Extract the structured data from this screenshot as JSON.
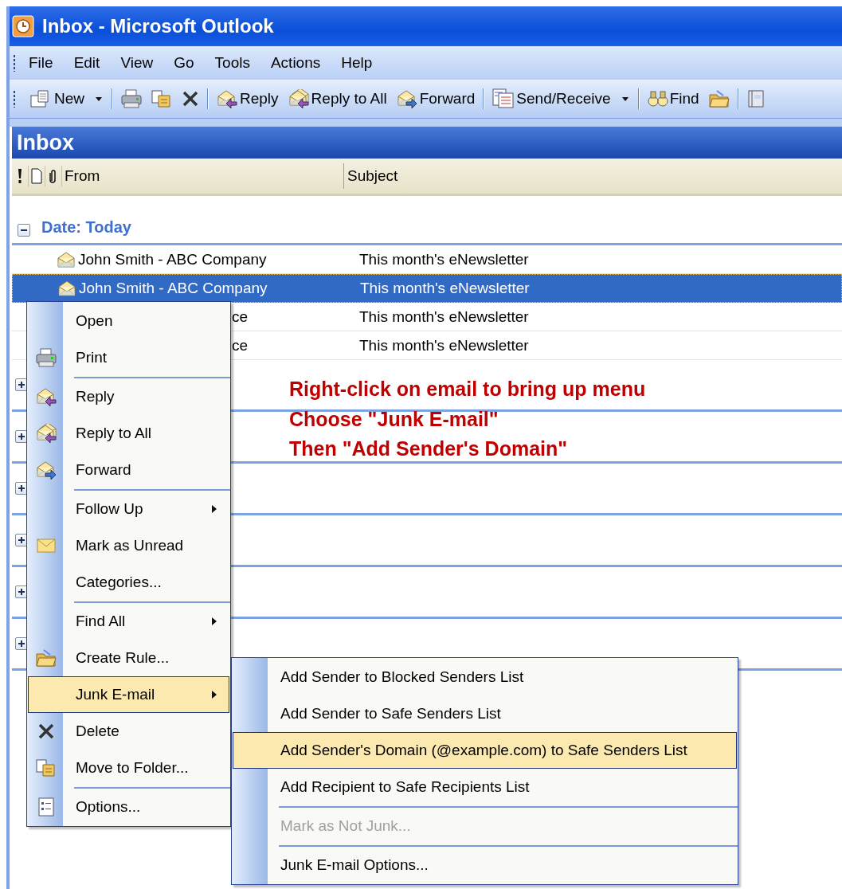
{
  "window": {
    "title": "Inbox - Microsoft Outlook"
  },
  "menu_bar": [
    {
      "label": "File"
    },
    {
      "label": "Edit"
    },
    {
      "label": "View"
    },
    {
      "label": "Go"
    },
    {
      "label": "Tools"
    },
    {
      "label": "Actions"
    },
    {
      "label": "Help"
    }
  ],
  "toolbar": [
    {
      "kind": "button",
      "label": "New",
      "dropdown": true
    },
    {
      "kind": "separator"
    },
    {
      "kind": "icon"
    },
    {
      "kind": "icon"
    },
    {
      "kind": "icon"
    },
    {
      "kind": "separator"
    },
    {
      "kind": "button",
      "label": "Reply",
      "dropdown": false
    },
    {
      "kind": "button",
      "label": "Reply to All",
      "dropdown": false
    },
    {
      "kind": "button",
      "label": "Forward",
      "dropdown": false
    },
    {
      "kind": "separator"
    },
    {
      "kind": "button",
      "label": "Send/Receive",
      "dropdown": true
    },
    {
      "kind": "separator"
    },
    {
      "kind": "button",
      "label": "Find",
      "dropdown": false
    },
    {
      "kind": "icon"
    },
    {
      "kind": "separator"
    },
    {
      "kind": "icon"
    }
  ],
  "folder": {
    "title": "Inbox"
  },
  "columns": [
    {
      "label": "From"
    },
    {
      "label": "Subject"
    }
  ],
  "groups": [
    {
      "label": "Date: Today",
      "expanded": true,
      "rows": [
        {
          "from": "John Smith - ABC Company",
          "subject": "This month's eNewsletter",
          "selected": false
        },
        {
          "from": "John Smith - ABC Company",
          "subject": "This month's eNewsletter",
          "selected": true
        },
        {
          "from": "ce",
          "subject": "This month's eNewsletter",
          "selected": false
        },
        {
          "from": "ce",
          "subject": "This month's eNewsletter",
          "selected": false
        }
      ]
    },
    {
      "expanded": false
    },
    {
      "expanded": false
    },
    {
      "expanded": false
    },
    {
      "expanded": false
    },
    {
      "expanded": false
    },
    {
      "expanded": false
    }
  ],
  "annotation": [
    "Right-click on email to bring up menu",
    "Choose \"Junk E-mail\"",
    "Then \"Add Sender's Domain\""
  ],
  "context_menu": [
    {
      "kind": "item",
      "label": "Open",
      "submenu": false,
      "selected": false
    },
    {
      "kind": "item",
      "label": "Print",
      "submenu": false,
      "selected": false
    },
    {
      "kind": "separator"
    },
    {
      "kind": "item",
      "label": "Reply",
      "submenu": false,
      "selected": false
    },
    {
      "kind": "item",
      "label": "Reply to All",
      "submenu": false,
      "selected": false
    },
    {
      "kind": "item",
      "label": "Forward",
      "submenu": false,
      "selected": false
    },
    {
      "kind": "separator"
    },
    {
      "kind": "item",
      "label": "Follow Up",
      "submenu": true,
      "selected": false
    },
    {
      "kind": "item",
      "label": "Mark as Unread",
      "submenu": false,
      "selected": false
    },
    {
      "kind": "item",
      "label": "Categories...",
      "submenu": false,
      "selected": false
    },
    {
      "kind": "separator"
    },
    {
      "kind": "item",
      "label": "Find All",
      "submenu": true,
      "selected": false
    },
    {
      "kind": "item",
      "label": "Create Rule...",
      "submenu": false,
      "selected": false
    },
    {
      "kind": "item",
      "label": "Junk E-mail",
      "submenu": true,
      "selected": true
    },
    {
      "kind": "item",
      "label": "Delete",
      "submenu": false,
      "selected": false
    },
    {
      "kind": "item",
      "label": "Move to Folder...",
      "submenu": false,
      "selected": false
    },
    {
      "kind": "separator"
    },
    {
      "kind": "item",
      "label": "Options...",
      "submenu": false,
      "selected": false
    }
  ],
  "junk_submenu": [
    {
      "kind": "item",
      "label": "Add Sender to Blocked Senders List",
      "selected": false,
      "disabled": false
    },
    {
      "kind": "item",
      "label": "Add Sender to Safe Senders List",
      "selected": false,
      "disabled": false
    },
    {
      "kind": "item",
      "label": "Add Sender's Domain (@example.com) to Safe Senders List",
      "selected": true,
      "disabled": false
    },
    {
      "kind": "item",
      "label": "Add Recipient to Safe Recipients List",
      "selected": false,
      "disabled": false
    },
    {
      "kind": "separator"
    },
    {
      "kind": "item",
      "label": "Mark as Not Junk...",
      "selected": false,
      "disabled": true
    },
    {
      "kind": "separator"
    },
    {
      "kind": "item",
      "label": "Junk E-mail Options...",
      "selected": false,
      "disabled": false
    }
  ]
}
